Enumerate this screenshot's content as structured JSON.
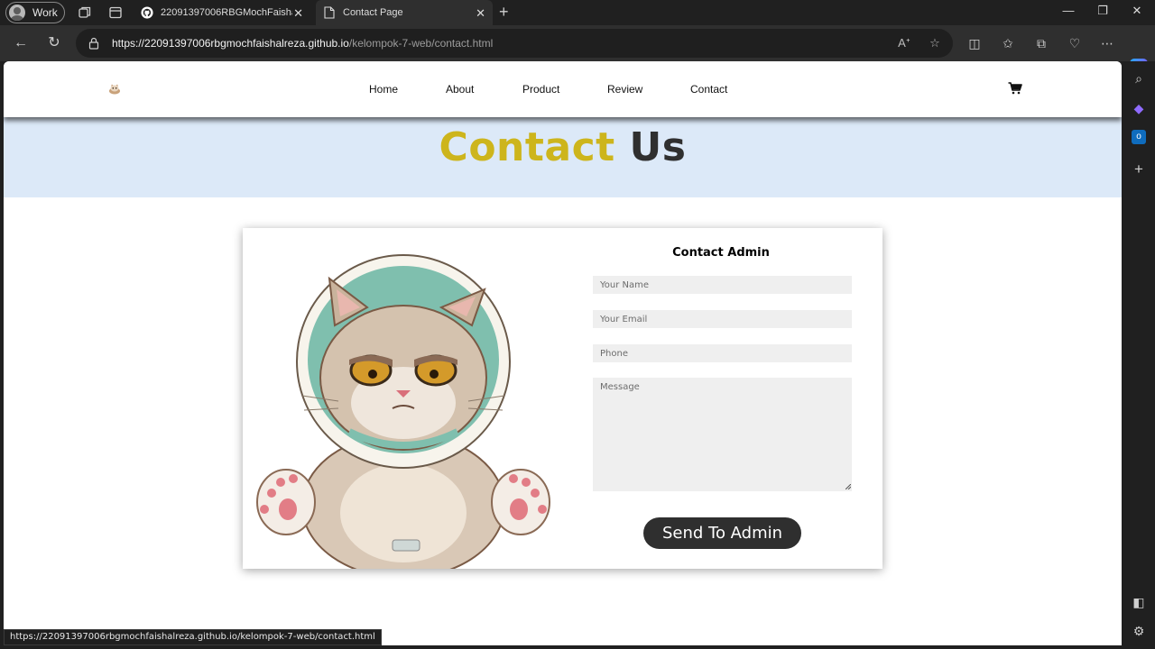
{
  "browser": {
    "profile_label": "Work",
    "tabs": [
      {
        "title": "22091397006RBGMochFaishalRe",
        "icon": "github-icon"
      },
      {
        "title": "Contact Page",
        "icon": "page-icon"
      }
    ],
    "url_host": "https://22091397006rbgmochfaishalreza.github.io",
    "url_path": "/kelompok-7-web/contact.html",
    "status_url": "https://22091397006rbgmochfaishalreza.github.io/kelompok-7-web/contact.html"
  },
  "site": {
    "nav": [
      "Home",
      "About",
      "Product",
      "Review",
      "Contact"
    ]
  },
  "hero": {
    "title_highlight": "Contact",
    "title_rest": "Us",
    "highlight_color": "#cdb51c"
  },
  "form": {
    "title": "Contact Admin",
    "name_placeholder": "Your Name",
    "email_placeholder": "Your Email",
    "phone_placeholder": "Phone",
    "message_placeholder": "Message",
    "submit_label": "Send To Admin"
  }
}
